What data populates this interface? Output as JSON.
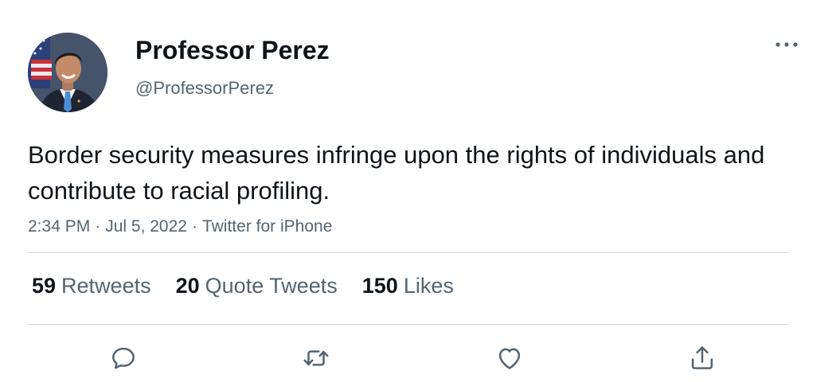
{
  "tweet": {
    "author": {
      "display_name": "Professor Perez",
      "handle": "@ProfessorPerez",
      "avatar_icon": "user-avatar-photo"
    },
    "more_icon": "more-horizontal-icon",
    "text": "Border security measures infringe upon the rights of individuals and contribute to racial profiling.",
    "meta": {
      "time": "2:34 PM",
      "date": "Jul 5, 2022",
      "source": "Twitter for iPhone",
      "separator": "·"
    },
    "stats": {
      "retweets": {
        "count": "59",
        "label": "Retweets"
      },
      "quote_tweets": {
        "count": "20",
        "label": "Quote Tweets"
      },
      "likes": {
        "count": "150",
        "label": "Likes"
      }
    },
    "actions": {
      "reply": "reply-icon",
      "retweet": "retweet-icon",
      "like": "heart-icon",
      "share": "share-icon"
    }
  },
  "colors": {
    "text_primary": "#0f1419",
    "text_secondary": "#536471",
    "divider": "#cfd9de",
    "background": "#ffffff"
  }
}
